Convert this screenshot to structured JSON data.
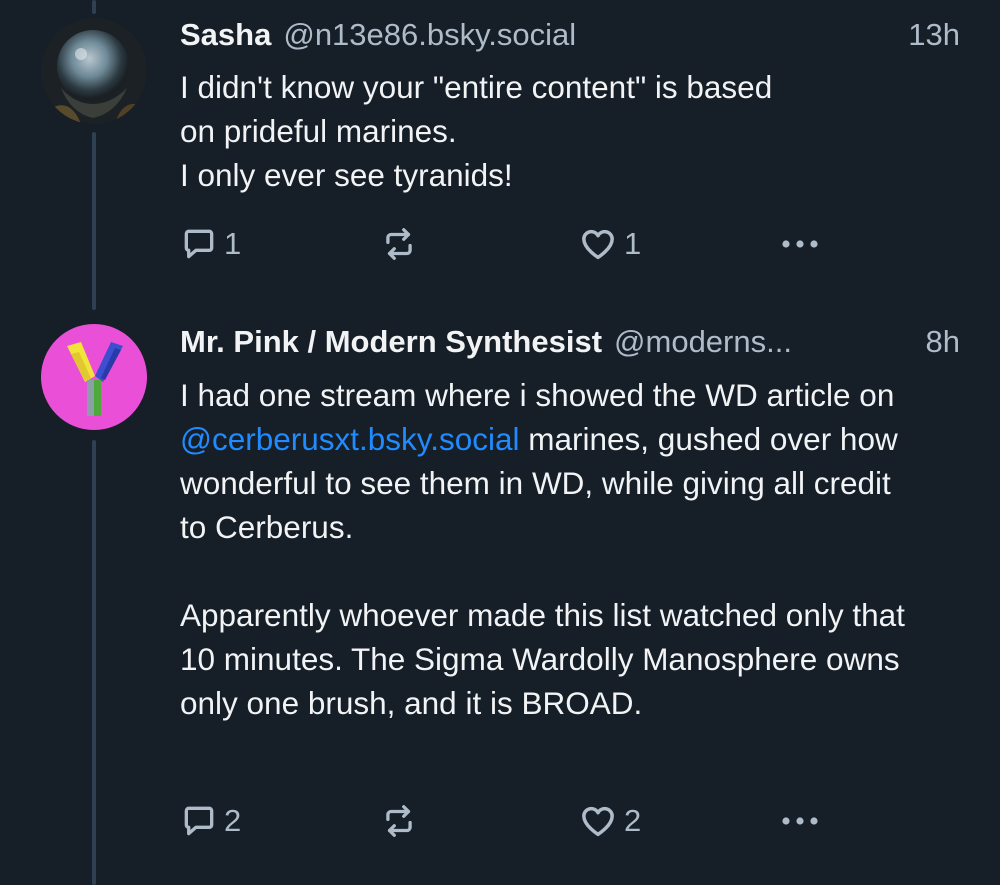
{
  "posts": [
    {
      "author_name": "Sasha",
      "author_handle": "@n13e86.bsky.social",
      "time": "13h",
      "avatar_icon": "helmet-avatar",
      "text_lines": [
        "I didn't know your \"entire content\" is based",
        "on prideful marines.",
        "I only ever see tyranids!"
      ],
      "reply_count": "1",
      "repost_count": "",
      "like_count": "1"
    },
    {
      "author_name": "Mr. Pink / Modern Synthesist",
      "author_handle": "@moderns...",
      "time": "8h",
      "avatar_icon": "pink-y-logo-avatar",
      "paragraph1_before_mention": "I had one stream where i showed the WD article on ",
      "mention": "@cerberusxt.bsky.social",
      "paragraph1_after_mention": " marines, gushed over how wonderful to see them in WD, while giving all credit to Cerberus.",
      "paragraph2": "Apparently whoever made this list watched only that 10 minutes. The Sigma Wardolly Manosphere owns only one brush, and it is BROAD.",
      "reply_count": "2",
      "repost_count": "",
      "like_count": "2"
    }
  ],
  "icons": {
    "reply": "reply-icon",
    "repost": "repost-icon",
    "like": "like-icon",
    "more": "more-options-icon"
  },
  "colors": {
    "background": "#161e27",
    "text": "#f1f3f5",
    "muted": "#aebbc9",
    "link": "#208bfe",
    "thread_line": "#2e4052",
    "avatar_pink": "#ea4fd7"
  }
}
